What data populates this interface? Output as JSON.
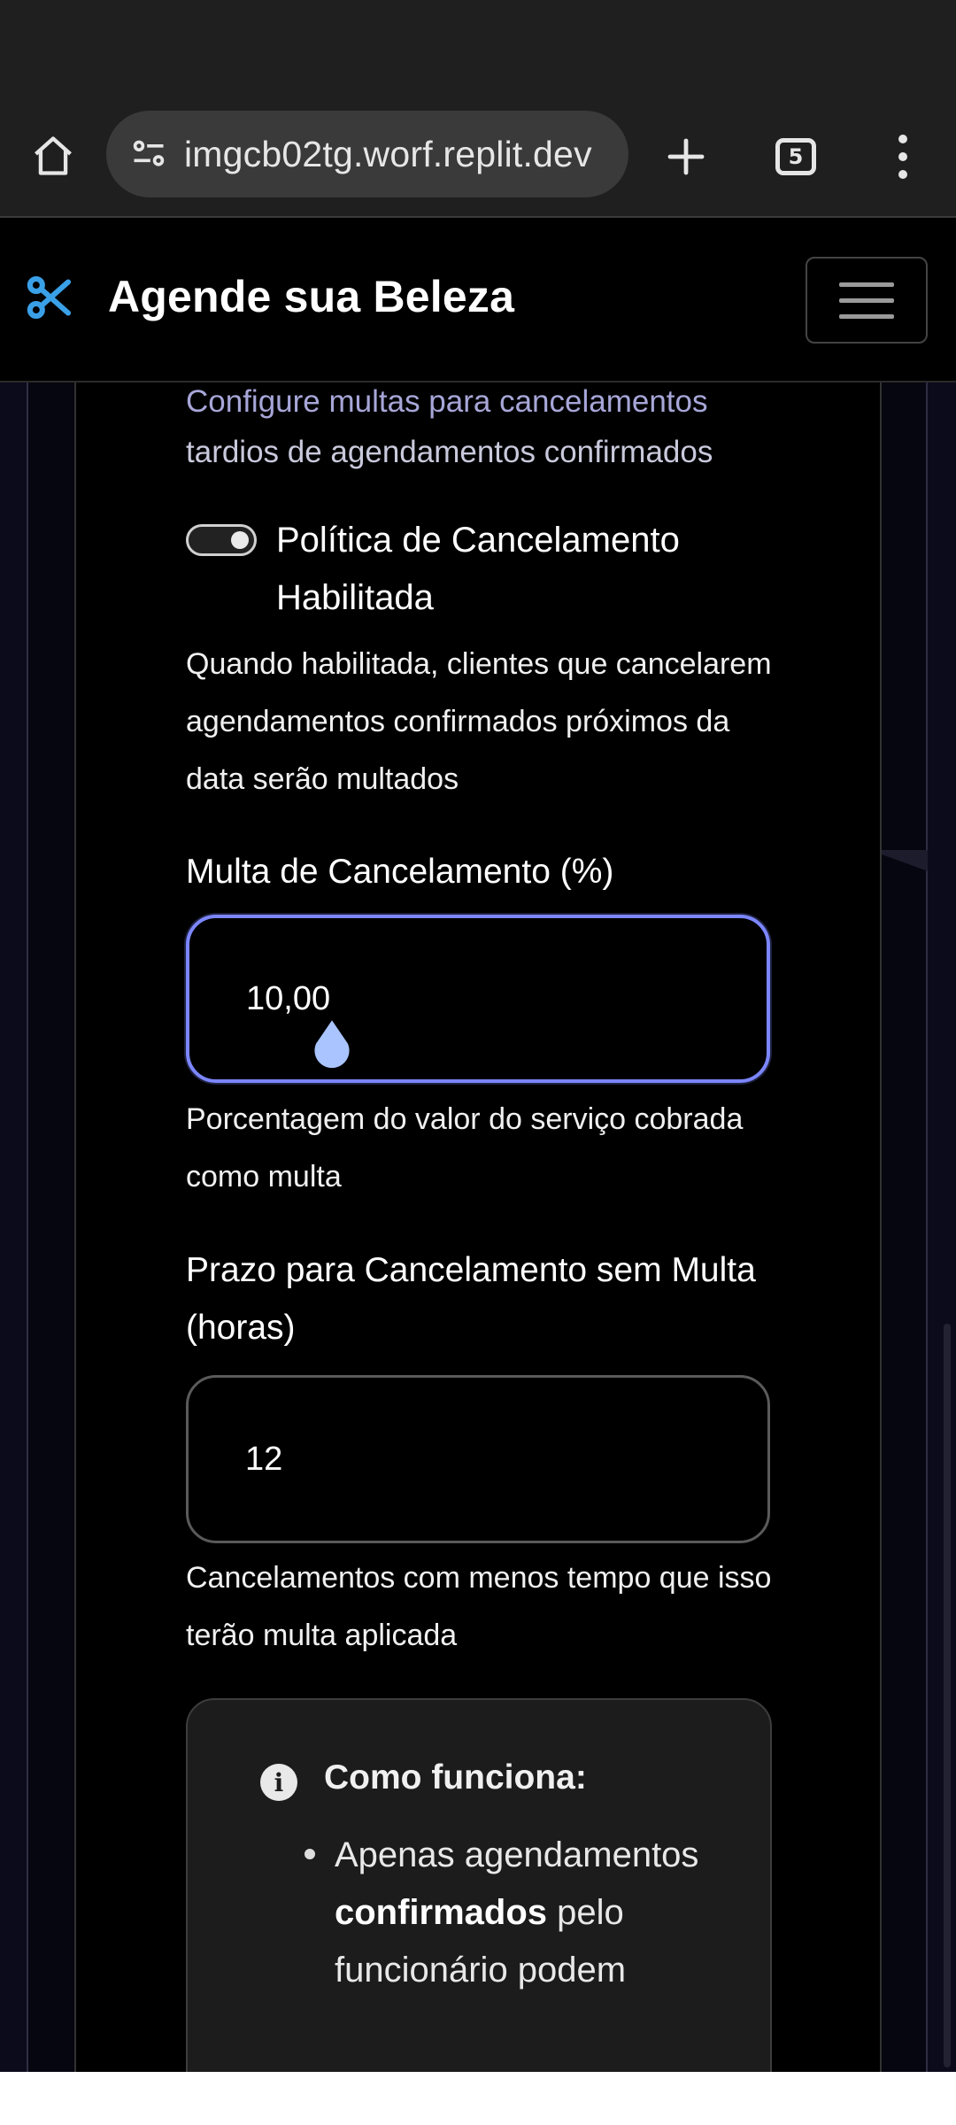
{
  "browser": {
    "url": "imgcb02tg.worf.replit.dev",
    "tab_count": "5"
  },
  "app": {
    "brand": "Agende sua Beleza"
  },
  "section": {
    "subtitle_line1": "Configure multas para cancelamentos",
    "subtitle_line2": "tardios de agendamentos confirmados",
    "toggle_label": "Política de Cancelamento Habilitada",
    "toggle_enabled": true,
    "toggle_help": "Quando habilitada, clientes que cancelarem agendamentos confirmados próximos da data serão multados"
  },
  "fee": {
    "label": "Multa de Cancelamento (%)",
    "value": "10,00",
    "help": "Porcentagem do valor do serviço cobrada como multa"
  },
  "deadline": {
    "label": "Prazo para Cancelamento sem Multa (horas)",
    "value": "12",
    "help": "Cancelamentos com menos tempo que isso terão multa aplicada"
  },
  "info": {
    "title": "Como funciona:",
    "bullet_prefix": "Apenas agendamentos",
    "bullet_bold": "confirmados",
    "bullet_suffix": "pelo funcionário podem"
  },
  "colors": {
    "accent_border": "#7c86ff",
    "brand_icon": "#3aa0e8",
    "cursor_drop": "#a9c4ff"
  }
}
